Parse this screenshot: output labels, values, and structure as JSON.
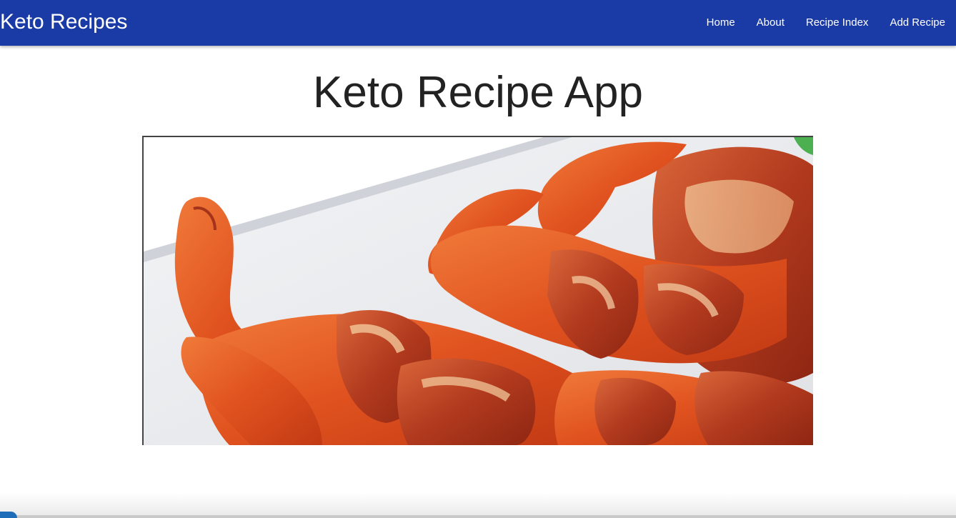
{
  "navbar": {
    "brand": "Keto Recipes",
    "links": [
      {
        "label": "Home"
      },
      {
        "label": "About"
      },
      {
        "label": "Recipe Index"
      },
      {
        "label": "Add Recipe"
      }
    ],
    "background_color": "#1a3aa6"
  },
  "main": {
    "title": "Keto Recipe App",
    "hero_image": {
      "alt": "Bacon-wrapped shrimp on a white plate"
    }
  }
}
